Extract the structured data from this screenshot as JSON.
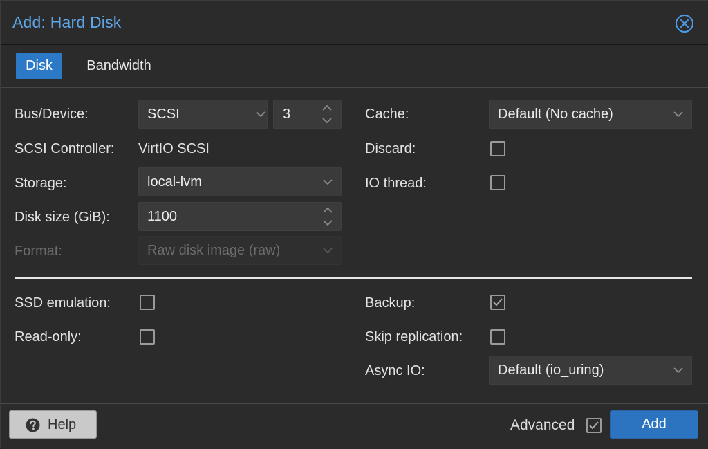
{
  "dialog": {
    "title": "Add: Hard Disk",
    "close_icon": "close-circle-icon",
    "accent_color": "#5ea6e8"
  },
  "tabs": [
    {
      "label": "Disk",
      "active": true
    },
    {
      "label": "Bandwidth",
      "active": false
    }
  ],
  "left": {
    "bus_device": {
      "label": "Bus/Device:",
      "bus_value": "SCSI",
      "device_value": "3"
    },
    "scsi_controller": {
      "label": "SCSI Controller:",
      "value": "VirtIO SCSI"
    },
    "storage": {
      "label": "Storage:",
      "value": "local-lvm"
    },
    "disk_size": {
      "label": "Disk size (GiB):",
      "value": "1100"
    },
    "format": {
      "label": "Format:",
      "value": "Raw disk image (raw)",
      "disabled": true
    }
  },
  "right": {
    "cache": {
      "label": "Cache:",
      "value": "Default (No cache)"
    },
    "discard": {
      "label": "Discard:",
      "checked": false
    },
    "io_thread": {
      "label": "IO thread:",
      "checked": false
    }
  },
  "advanced": {
    "ssd_emulation": {
      "label": "SSD emulation:",
      "checked": false
    },
    "read_only": {
      "label": "Read-only:",
      "checked": false
    },
    "backup": {
      "label": "Backup:",
      "checked": true
    },
    "skip_replication": {
      "label": "Skip replication:",
      "checked": false
    },
    "async_io": {
      "label": "Async IO:",
      "value": "Default (io_uring)"
    }
  },
  "footer": {
    "help_label": "Help",
    "help_icon": "question-circle-icon",
    "advanced_label": "Advanced",
    "advanced_checked": true,
    "add_label": "Add",
    "add_color": "#2c73c0"
  }
}
